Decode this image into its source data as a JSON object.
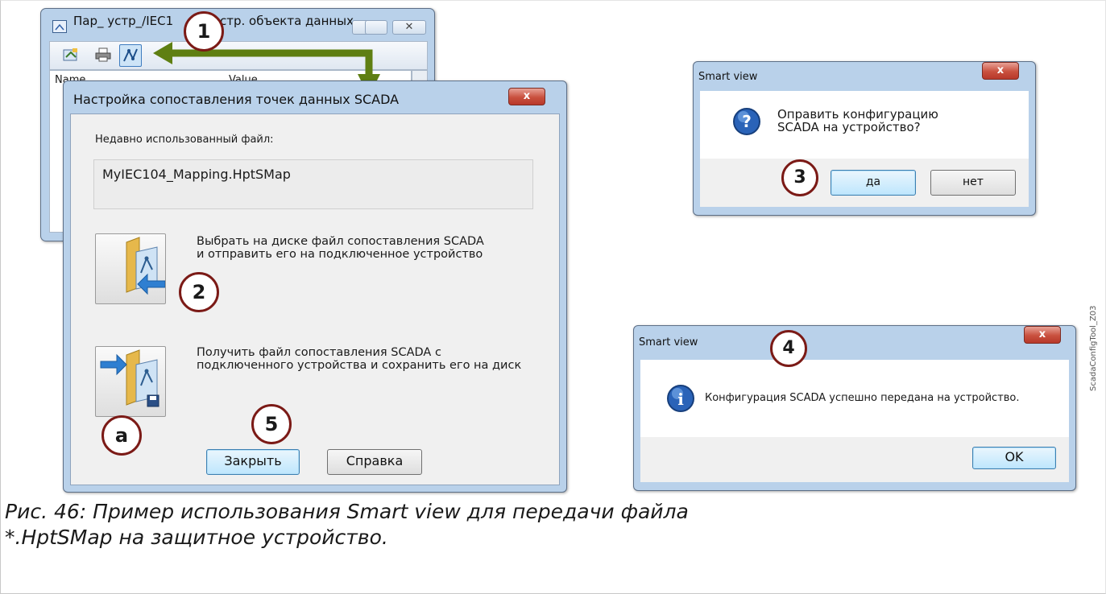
{
  "params_window": {
    "title": "Пар_ устр_/IEC1",
    "title_hidden_tail": "стр. объекта данных",
    "col_name": "Name",
    "col_value": "Value"
  },
  "mapping_dialog": {
    "title": "Настройка сопоставления точек данных SCADA",
    "close_glyph": "x",
    "recent_label": "Недавно использованный файл:",
    "recent_file": "MyIEC104_Mapping.HptSMap",
    "send_text": "Выбрать на диске файл сопоставления SCADA\nи отправить его на подключенное устройство",
    "receive_text": "Получить файл сопоставления SCADA с\nподключенного устройства и сохранить его на диск",
    "close_button": "Закрыть",
    "help_button": "Справка"
  },
  "confirm_dialog": {
    "title": "Smart view",
    "close_glyph": "x",
    "question_line1": "Оправить конфигурацию",
    "question_line2": "SCADA на устройство?",
    "yes_button": "да",
    "no_button": "нет"
  },
  "info_dialog": {
    "title": "Smart view",
    "close_glyph": "x",
    "message": "Конфигурация SCADA успешно передана на устройство.",
    "ok_button": "OK"
  },
  "callouts": {
    "c1": "1",
    "c2": "2",
    "c3": "3",
    "c4": "4",
    "c5": "5",
    "ca": "a"
  },
  "colors": {
    "callout_border": "#7b1a16",
    "arrow": "#5f7f12",
    "window_frame": "#b9d1ea",
    "close_red": "#c9503e"
  },
  "caption": "Рис. 46: Пример использования Smart view для передачи файла *.HptSMap на защитное устройство.",
  "side_code": "ScadaConfigTool_Z03"
}
